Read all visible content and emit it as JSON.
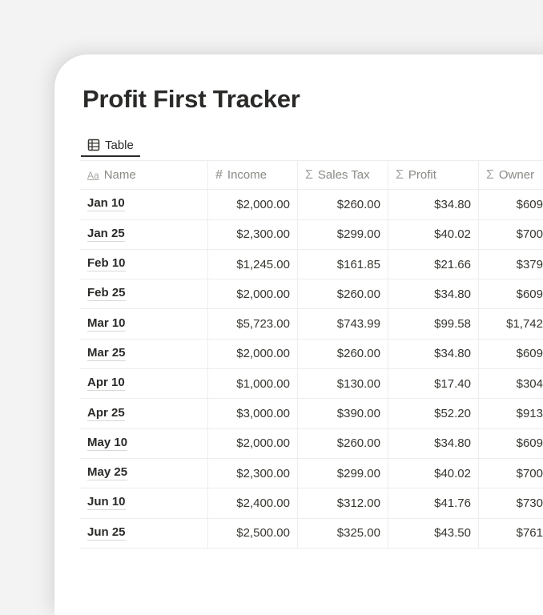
{
  "page": {
    "title": "Profit First Tracker",
    "view_tabs": [
      {
        "label": "Table",
        "icon": "table-icon",
        "active": true
      }
    ]
  },
  "table": {
    "columns": [
      {
        "label": "Name",
        "icon": "text-property-icon",
        "glyph": "Aa"
      },
      {
        "label": "Income",
        "icon": "number-property-icon",
        "glyph": "#"
      },
      {
        "label": "Sales Tax",
        "icon": "formula-property-icon",
        "glyph": "Σ"
      },
      {
        "label": "Profit",
        "icon": "formula-property-icon",
        "glyph": "Σ"
      },
      {
        "label": "Owner",
        "icon": "formula-property-icon",
        "glyph": "Σ"
      }
    ],
    "rows": [
      {
        "name": "Jan 10",
        "income": "$2,000.00",
        "sales_tax": "$260.00",
        "profit": "$34.80",
        "owner": "$609"
      },
      {
        "name": "Jan 25",
        "income": "$2,300.00",
        "sales_tax": "$299.00",
        "profit": "$40.02",
        "owner": "$700"
      },
      {
        "name": "Feb 10",
        "income": "$1,245.00",
        "sales_tax": "$161.85",
        "profit": "$21.66",
        "owner": "$379"
      },
      {
        "name": "Feb 25",
        "income": "$2,000.00",
        "sales_tax": "$260.00",
        "profit": "$34.80",
        "owner": "$609"
      },
      {
        "name": "Mar 10",
        "income": "$5,723.00",
        "sales_tax": "$743.99",
        "profit": "$99.58",
        "owner": "$1,742"
      },
      {
        "name": "Mar 25",
        "income": "$2,000.00",
        "sales_tax": "$260.00",
        "profit": "$34.80",
        "owner": "$609"
      },
      {
        "name": "Apr 10",
        "income": "$1,000.00",
        "sales_tax": "$130.00",
        "profit": "$17.40",
        "owner": "$304"
      },
      {
        "name": "Apr 25",
        "income": "$3,000.00",
        "sales_tax": "$390.00",
        "profit": "$52.20",
        "owner": "$913"
      },
      {
        "name": "May 10",
        "income": "$2,000.00",
        "sales_tax": "$260.00",
        "profit": "$34.80",
        "owner": "$609"
      },
      {
        "name": "May 25",
        "income": "$2,300.00",
        "sales_tax": "$299.00",
        "profit": "$40.02",
        "owner": "$700"
      },
      {
        "name": "Jun 10",
        "income": "$2,400.00",
        "sales_tax": "$312.00",
        "profit": "$41.76",
        "owner": "$730"
      },
      {
        "name": "Jun 25",
        "income": "$2,500.00",
        "sales_tax": "$325.00",
        "profit": "$43.50",
        "owner": "$761"
      }
    ]
  },
  "colors": {
    "background": "#f3f3f3",
    "card": "#ffffff",
    "text": "#37352f",
    "header_text": "#8a8984",
    "grid_line": "#ededeb"
  }
}
